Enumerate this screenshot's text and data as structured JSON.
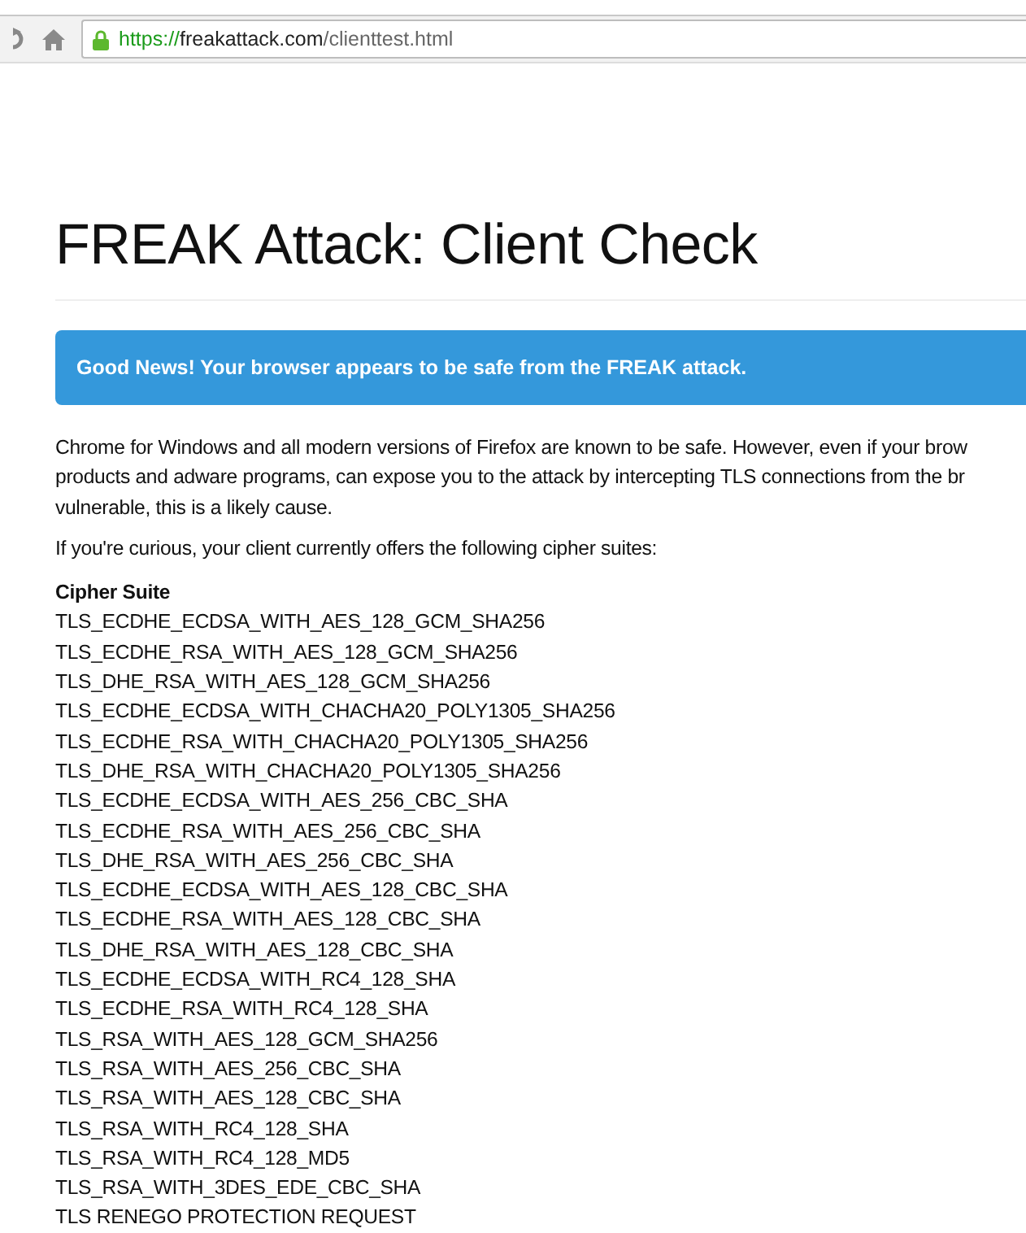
{
  "browser": {
    "url": {
      "scheme": "https://",
      "host": "freakattack.com",
      "path": "/clienttest.html"
    },
    "secure": true
  },
  "page": {
    "title": "FREAK Attack: Client Check",
    "alert": {
      "kind": "info",
      "text": "**Good News!** Your browser appears to be safe from the FREAK attack."
    },
    "paragraph_lines": [
      "Chrome for Windows and all modern versions of Firefox are known to be safe. However, even if your brow",
      "products and adware programs, can expose you to the attack by intercepting TLS connections from the br",
      "vulnerable, this is a likely cause."
    ],
    "intro": "If you're curious, your client currently offers the following cipher suites:",
    "table": {
      "columns": [
        "Cipher Suite"
      ],
      "rows": [
        "TLS_ECDHE_ECDSA_WITH_AES_128_GCM_SHA256",
        "TLS_ECDHE_RSA_WITH_AES_128_GCM_SHA256",
        "TLS_DHE_RSA_WITH_AES_128_GCM_SHA256",
        "TLS_ECDHE_ECDSA_WITH_CHACHA20_POLY1305_SHA256",
        "TLS_ECDHE_RSA_WITH_CHACHA20_POLY1305_SHA256",
        "TLS_DHE_RSA_WITH_CHACHA20_POLY1305_SHA256",
        "TLS_ECDHE_ECDSA_WITH_AES_256_CBC_SHA",
        "TLS_ECDHE_RSA_WITH_AES_256_CBC_SHA",
        "TLS_DHE_RSA_WITH_AES_256_CBC_SHA",
        "TLS_ECDHE_ECDSA_WITH_AES_128_CBC_SHA",
        "TLS_ECDHE_RSA_WITH_AES_128_CBC_SHA",
        "TLS_DHE_RSA_WITH_AES_128_CBC_SHA",
        "TLS_ECDHE_ECDSA_WITH_RC4_128_SHA",
        "TLS_ECDHE_RSA_WITH_RC4_128_SHA",
        "TLS_RSA_WITH_AES_128_GCM_SHA256",
        "TLS_RSA_WITH_AES_256_CBC_SHA",
        "TLS_RSA_WITH_AES_128_CBC_SHA",
        "TLS_RSA_WITH_RC4_128_SHA",
        "TLS_RSA_WITH_RC4_128_MD5",
        "TLS_RSA_WITH_3DES_EDE_CBC_SHA",
        "TLS RENEGO PROTECTION REQUEST"
      ]
    }
  }
}
